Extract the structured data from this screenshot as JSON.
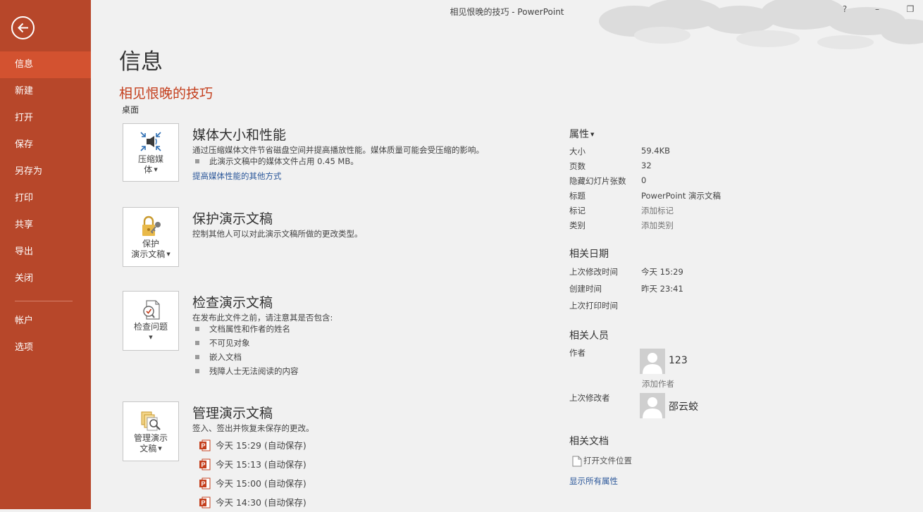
{
  "window": {
    "title": "相见恨晚的技巧 - PowerPoint",
    "help": "?",
    "minimize": "–",
    "restore": "❐"
  },
  "sidebar": {
    "items": [
      {
        "label": "信息"
      },
      {
        "label": "新建"
      },
      {
        "label": "打开"
      },
      {
        "label": "保存"
      },
      {
        "label": "另存为"
      },
      {
        "label": "打印"
      },
      {
        "label": "共享"
      },
      {
        "label": "导出"
      },
      {
        "label": "关闭"
      },
      {
        "label": "帐户"
      },
      {
        "label": "选项"
      }
    ],
    "active": "信息"
  },
  "page": {
    "title": "信息",
    "doc_name": "相见恨晚的技巧",
    "doc_location": "桌面"
  },
  "sections": {
    "media": {
      "button_line1": "压缩媒",
      "button_line2": "体",
      "title": "媒体大小和性能",
      "desc": "通过压缩媒体文件节省磁盘空间并提高播放性能。媒体质量可能会受压缩的影响。",
      "bullet": "此演示文稿中的媒体文件占用 0.45 MB。",
      "link": "提高媒体性能的其他方式"
    },
    "protect": {
      "button_line1": "保护",
      "button_line2": "演示文稿",
      "title": "保护演示文稿",
      "desc": "控制其他人可以对此演示文稿所做的更改类型。"
    },
    "inspect": {
      "button_line1": "检查问题",
      "title": "检查演示文稿",
      "desc": "在发布此文件之前，请注意其是否包含:",
      "bullets": [
        "文档属性和作者的姓名",
        "不可见对象",
        "嵌入文档",
        "残障人士无法阅读的内容"
      ]
    },
    "manage": {
      "button_line1": "管理演示",
      "button_line2": "文稿",
      "title": "管理演示文稿",
      "desc": "签入、签出并恢复未保存的更改。",
      "versions": [
        "今天 15:29 (自动保存)",
        "今天 15:13 (自动保存)",
        "今天 15:00 (自动保存)",
        "今天 14:30 (自动保存)"
      ]
    }
  },
  "properties": {
    "heading": "属性",
    "rows": [
      {
        "key": "大小",
        "value": "59.4KB",
        "muted": false
      },
      {
        "key": "页数",
        "value": "32",
        "muted": false
      },
      {
        "key": "隐藏幻灯片张数",
        "value": "0",
        "muted": false
      },
      {
        "key": "标题",
        "value": "PowerPoint 演示文稿",
        "muted": false
      },
      {
        "key": "标记",
        "value": "添加标记",
        "muted": true
      },
      {
        "key": "类别",
        "value": "添加类别",
        "muted": true
      }
    ]
  },
  "dates": {
    "heading": "相关日期",
    "rows": [
      {
        "key": "上次修改时间",
        "value": "今天 15:29"
      },
      {
        "key": "创建时间",
        "value": "昨天 23:41"
      },
      {
        "key": "上次打印时间",
        "value": ""
      }
    ]
  },
  "people": {
    "heading": "相关人员",
    "author_label": "作者",
    "author_name": "123",
    "add_author": "添加作者",
    "modifier_label": "上次修改者",
    "modifier_name": "邵云蛟"
  },
  "documents": {
    "heading": "相关文档",
    "open_location": "打开文件位置",
    "show_all": "显示所有属性"
  },
  "colors": {
    "sidebar": "#b7472a",
    "sidebar_active": "#d35230",
    "accent_title": "#c43e1c",
    "link": "#2b579a",
    "background": "#f1f1f1"
  }
}
